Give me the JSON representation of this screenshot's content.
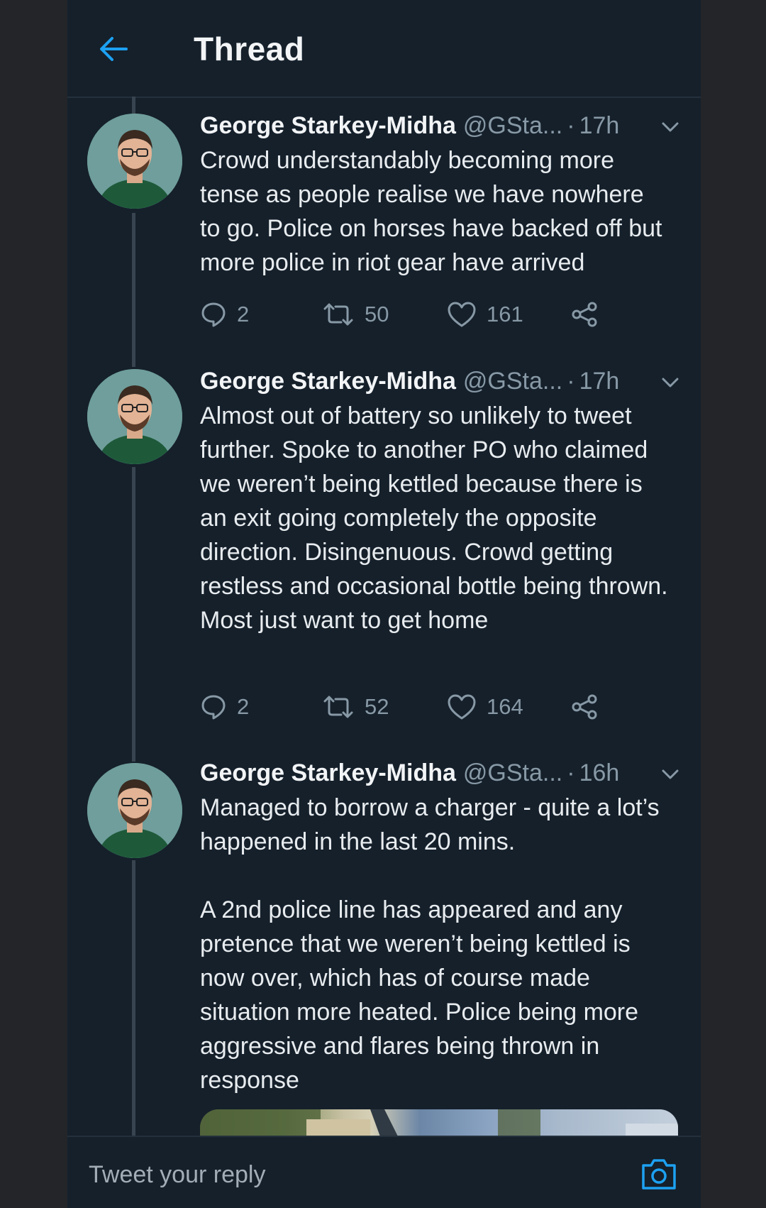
{
  "header": {
    "title": "Thread"
  },
  "colors": {
    "background": "#15202b",
    "outer_background": "#232529",
    "accent": "#1da1f2",
    "secondary_text": "#8899a6"
  },
  "tweets": [
    {
      "name": "George Starkey-Midha",
      "handle": "@GSta...",
      "separator": "·",
      "time": "17h",
      "paragraphs": [
        "Crowd understandably becoming more tense as people realise we have nowhere to go. Police on horses have backed off but more police in riot gear have arrived"
      ],
      "replies": "2",
      "retweets": "50",
      "likes": "161"
    },
    {
      "name": "George Starkey-Midha",
      "handle": "@GSta...",
      "separator": "·",
      "time": "17h",
      "paragraphs": [
        "Almost out of battery so unlikely to tweet further. Spoke to another PO who claimed we weren’t being kettled because there is an exit going completely the opposite direction. Disingenuous. Crowd getting restless and occasional bottle being thrown. Most just want to get home"
      ],
      "replies": "2",
      "retweets": "52",
      "likes": "164"
    },
    {
      "name": "George Starkey-Midha",
      "handle": "@GSta...",
      "separator": "·",
      "time": "16h",
      "paragraphs": [
        "Managed to borrow a charger - quite a lot’s happened in the last 20 mins.",
        "A 2nd police line has appeared and any pretence that we weren’t being kettled is now over, which has of course made situation more heated. Police being more aggressive and flares being thrown in response"
      ]
    }
  ],
  "icons": {
    "back": "arrow-left-icon",
    "caret": "chevron-down-icon",
    "reply": "speech-bubble-icon",
    "retweet": "retweet-icon",
    "like": "heart-icon",
    "share": "share-icon",
    "camera": "camera-icon"
  },
  "reply_bar": {
    "placeholder": "Tweet your reply"
  }
}
